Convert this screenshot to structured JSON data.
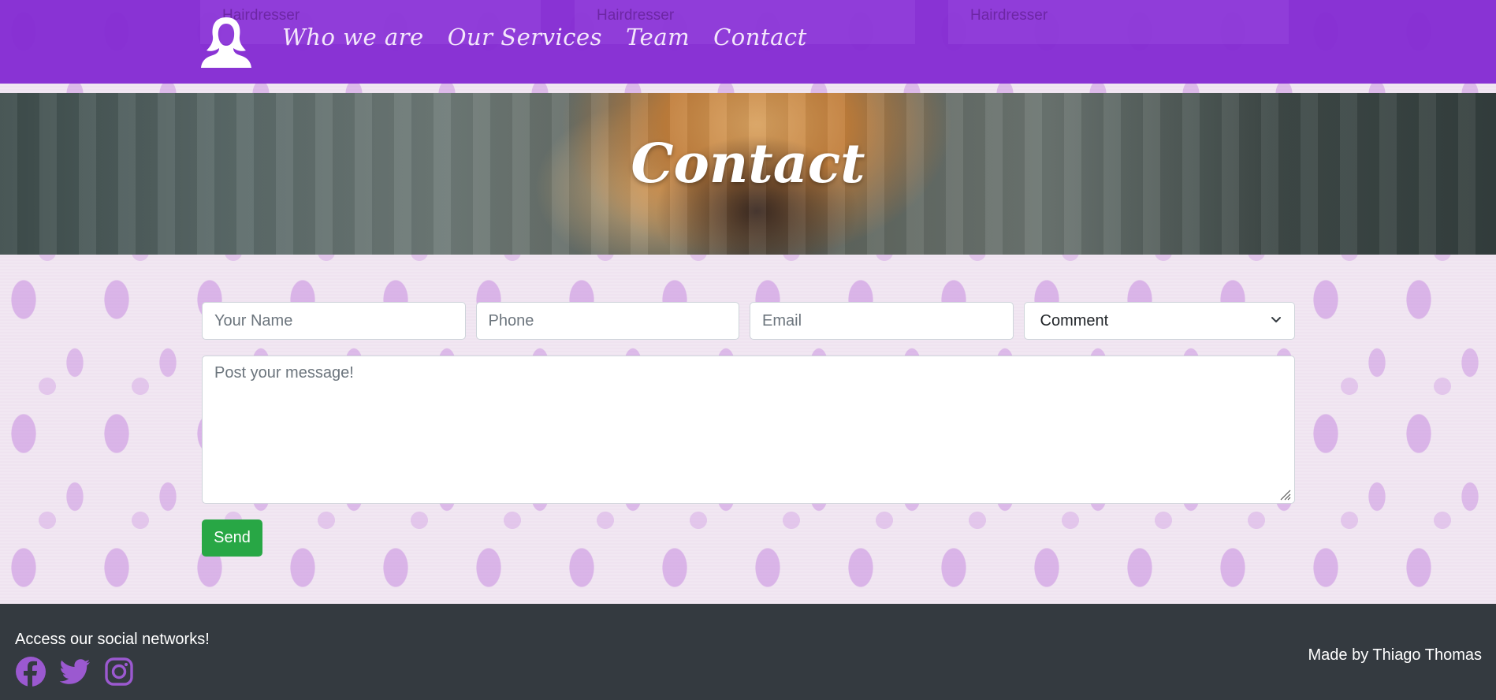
{
  "navbar": {
    "ghost_cards": [
      "Hairdresser",
      "Hairdresser",
      "Hairdresser"
    ],
    "brand_icon": "woman-silhouette-icon",
    "links": [
      "Who we are",
      "Our Services",
      "Team",
      "Contact"
    ]
  },
  "hero": {
    "title": "Contact"
  },
  "form": {
    "name_placeholder": "Your Name",
    "phone_placeholder": "Phone",
    "email_placeholder": "Email",
    "subject_selected": "Comment",
    "message_placeholder": "Post your message!",
    "send_label": "Send"
  },
  "footer": {
    "social_text": "Access our social networks!",
    "social_icons": [
      "facebook-icon",
      "twitter-icon",
      "instagram-icon"
    ],
    "credit": "Made by Thiago Thomas"
  },
  "colors": {
    "navbar": "#842cd2",
    "accent_purple": "#9b59d0",
    "send_button": "#28a745",
    "footer": "#343a40"
  }
}
